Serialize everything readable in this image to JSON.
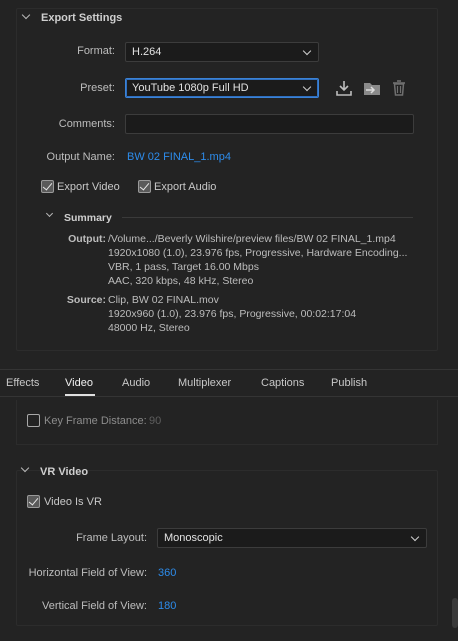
{
  "export_settings": {
    "title": "Export Settings",
    "format_label": "Format:",
    "format_value": "H.264",
    "preset_label": "Preset:",
    "preset_value": "YouTube 1080p Full HD",
    "comments_label": "Comments:",
    "comments_value": "",
    "output_name_label": "Output Name:",
    "output_name_value": "BW 02 FINAL_1.mp4",
    "export_video_label": "Export Video",
    "export_video_checked": true,
    "export_audio_label": "Export Audio",
    "export_audio_checked": true,
    "icons": [
      "save-preset-icon",
      "import-preset-icon",
      "delete-preset-icon"
    ]
  },
  "summary": {
    "title": "Summary",
    "output_key": "Output:",
    "output_lines": [
      "/Volume.../Beverly Wilshire/preview files/BW 02 FINAL_1.mp4",
      "1920x1080 (1.0), 23.976 fps, Progressive, Hardware Encoding...",
      "VBR, 1 pass, Target 16.00 Mbps",
      "AAC, 320 kbps, 48 kHz, Stereo"
    ],
    "source_key": "Source:",
    "source_lines": [
      "Clip, BW 02 FINAL.mov",
      "1920x960 (1.0), 23.976 fps, Progressive, 00:02:17:04",
      "48000 Hz, Stereo"
    ]
  },
  "tabs": [
    "Effects",
    "Video",
    "Audio",
    "Multiplexer",
    "Captions",
    "Publish"
  ],
  "active_tab": "Video",
  "video": {
    "key_frame_label": "Key Frame Distance:",
    "key_frame_value": "90",
    "key_frame_checked": false
  },
  "vr_video": {
    "title": "VR Video",
    "video_is_vr_label": "Video Is VR",
    "video_is_vr_checked": true,
    "frame_layout_label": "Frame Layout:",
    "frame_layout_value": "Monoscopic",
    "hfov_label": "Horizontal Field of View:",
    "hfov_value": "360",
    "vfov_label": "Vertical Field of View:",
    "vfov_value": "180"
  },
  "colors": {
    "background": "#232323",
    "accent_blue": "#2d8ceb",
    "focus_blue": "#3b82d6",
    "text": "#c8c8c8"
  }
}
